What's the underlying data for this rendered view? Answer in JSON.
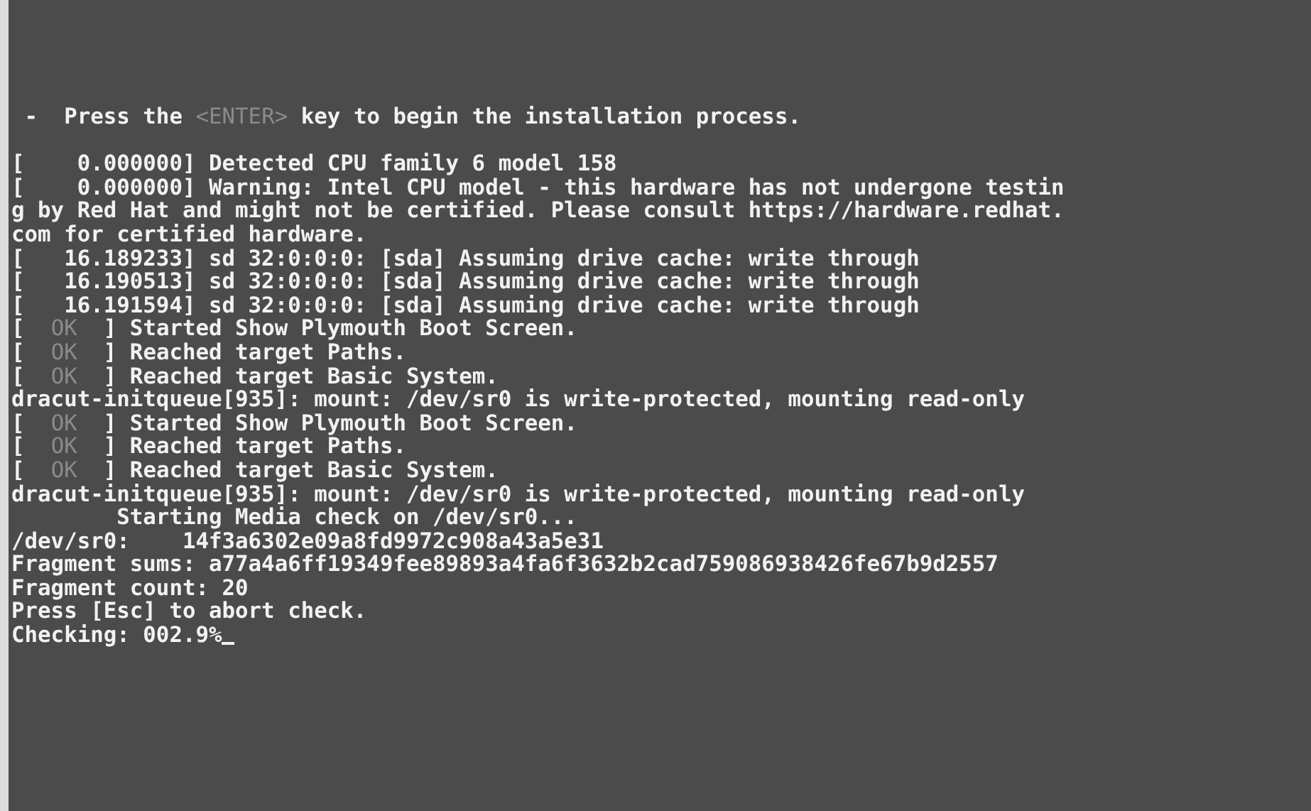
{
  "console": {
    "lines": [
      {
        "segments": [
          {
            "text": " -  Press the ",
            "dim": false
          },
          {
            "text": "<ENTER>",
            "dim": true
          },
          {
            "text": " key to begin the installation process.",
            "dim": false
          }
        ]
      },
      {
        "gap_before": true,
        "segments": [
          {
            "text": "[    0.000000] Detected CPU family 6 model 158",
            "dim": false
          }
        ]
      },
      {
        "segments": [
          {
            "text": "[    0.000000] Warning: Intel CPU model - this hardware has not undergone testin",
            "dim": false
          }
        ]
      },
      {
        "segments": [
          {
            "text": "g by Red Hat and might not be certified. Please consult https://hardware.redhat.",
            "dim": false
          }
        ]
      },
      {
        "segments": [
          {
            "text": "com for certified hardware.",
            "dim": false
          }
        ]
      },
      {
        "segments": [
          {
            "text": "[   16.189233] sd 32:0:0:0: [sda] Assuming drive cache: write through",
            "dim": false
          }
        ]
      },
      {
        "segments": [
          {
            "text": "[   16.190513] sd 32:0:0:0: [sda] Assuming drive cache: write through",
            "dim": false
          }
        ]
      },
      {
        "segments": [
          {
            "text": "[   16.191594] sd 32:0:0:0: [sda] Assuming drive cache: write through",
            "dim": false
          }
        ]
      },
      {
        "segments": [
          {
            "text": "[  ",
            "dim": false
          },
          {
            "text": "OK",
            "dim": true
          },
          {
            "text": "  ] Started Show Plymouth Boot Screen.",
            "dim": false
          }
        ]
      },
      {
        "segments": [
          {
            "text": "[  ",
            "dim": false
          },
          {
            "text": "OK",
            "dim": true
          },
          {
            "text": "  ] Reached target Paths.",
            "dim": false
          }
        ]
      },
      {
        "segments": [
          {
            "text": "[  ",
            "dim": false
          },
          {
            "text": "OK",
            "dim": true
          },
          {
            "text": "  ] Reached target Basic System.",
            "dim": false
          }
        ]
      },
      {
        "segments": [
          {
            "text": "dracut-initqueue[935]: mount: /dev/sr0 is write-protected, mounting read-only",
            "dim": false
          }
        ]
      },
      {
        "segments": [
          {
            "text": "[  ",
            "dim": false
          },
          {
            "text": "OK",
            "dim": true
          },
          {
            "text": "  ] Started Show Plymouth Boot Screen.",
            "dim": false
          }
        ]
      },
      {
        "segments": [
          {
            "text": "[  ",
            "dim": false
          },
          {
            "text": "OK",
            "dim": true
          },
          {
            "text": "  ] Reached target Paths.",
            "dim": false
          }
        ]
      },
      {
        "segments": [
          {
            "text": "[  ",
            "dim": false
          },
          {
            "text": "OK",
            "dim": true
          },
          {
            "text": "  ] Reached target Basic System.",
            "dim": false
          }
        ]
      },
      {
        "segments": [
          {
            "text": "dracut-initqueue[935]: mount: /dev/sr0 is write-protected, mounting read-only",
            "dim": false
          }
        ]
      },
      {
        "segments": [
          {
            "text": "        Starting Media check on /dev/sr0...",
            "dim": false
          }
        ]
      },
      {
        "segments": [
          {
            "text": "/dev/sr0:    14f3a6302e09a8fd9972c908a43a5e31",
            "dim": false
          }
        ]
      },
      {
        "segments": [
          {
            "text": "Fragment sums: a77a4a6ff19349fee89893a4fa6f3632b2cad759086938426fe67b9d2557",
            "dim": false
          }
        ]
      },
      {
        "segments": [
          {
            "text": "Fragment count: 20",
            "dim": false
          }
        ]
      },
      {
        "segments": [
          {
            "text": "Press [Esc] to abort check.",
            "dim": false
          }
        ]
      },
      {
        "segments": [
          {
            "text": "Checking: 002.9%",
            "dim": false
          }
        ],
        "cursor": true
      }
    ]
  }
}
